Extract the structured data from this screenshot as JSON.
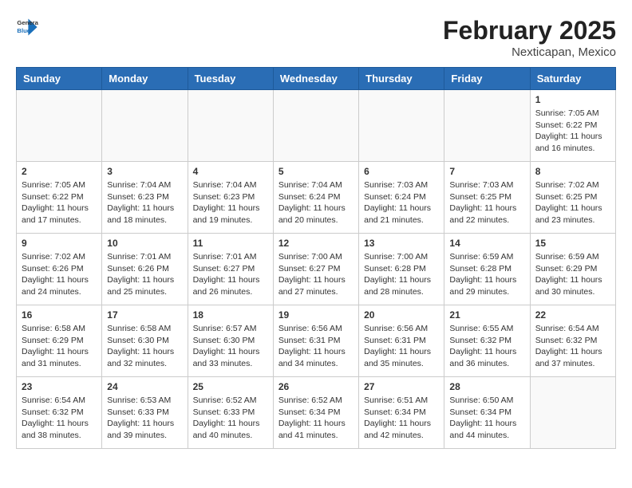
{
  "header": {
    "logo_text_general": "General",
    "logo_text_blue": "Blue",
    "month_year": "February 2025",
    "location": "Nexticapan, Mexico"
  },
  "weekdays": [
    "Sunday",
    "Monday",
    "Tuesday",
    "Wednesday",
    "Thursday",
    "Friday",
    "Saturday"
  ],
  "weeks": [
    [
      {
        "day": "",
        "info": ""
      },
      {
        "day": "",
        "info": ""
      },
      {
        "day": "",
        "info": ""
      },
      {
        "day": "",
        "info": ""
      },
      {
        "day": "",
        "info": ""
      },
      {
        "day": "",
        "info": ""
      },
      {
        "day": "1",
        "info": "Sunrise: 7:05 AM\nSunset: 6:22 PM\nDaylight: 11 hours\nand 16 minutes."
      }
    ],
    [
      {
        "day": "2",
        "info": "Sunrise: 7:05 AM\nSunset: 6:22 PM\nDaylight: 11 hours\nand 17 minutes."
      },
      {
        "day": "3",
        "info": "Sunrise: 7:04 AM\nSunset: 6:23 PM\nDaylight: 11 hours\nand 18 minutes."
      },
      {
        "day": "4",
        "info": "Sunrise: 7:04 AM\nSunset: 6:23 PM\nDaylight: 11 hours\nand 19 minutes."
      },
      {
        "day": "5",
        "info": "Sunrise: 7:04 AM\nSunset: 6:24 PM\nDaylight: 11 hours\nand 20 minutes."
      },
      {
        "day": "6",
        "info": "Sunrise: 7:03 AM\nSunset: 6:24 PM\nDaylight: 11 hours\nand 21 minutes."
      },
      {
        "day": "7",
        "info": "Sunrise: 7:03 AM\nSunset: 6:25 PM\nDaylight: 11 hours\nand 22 minutes."
      },
      {
        "day": "8",
        "info": "Sunrise: 7:02 AM\nSunset: 6:25 PM\nDaylight: 11 hours\nand 23 minutes."
      }
    ],
    [
      {
        "day": "9",
        "info": "Sunrise: 7:02 AM\nSunset: 6:26 PM\nDaylight: 11 hours\nand 24 minutes."
      },
      {
        "day": "10",
        "info": "Sunrise: 7:01 AM\nSunset: 6:26 PM\nDaylight: 11 hours\nand 25 minutes."
      },
      {
        "day": "11",
        "info": "Sunrise: 7:01 AM\nSunset: 6:27 PM\nDaylight: 11 hours\nand 26 minutes."
      },
      {
        "day": "12",
        "info": "Sunrise: 7:00 AM\nSunset: 6:27 PM\nDaylight: 11 hours\nand 27 minutes."
      },
      {
        "day": "13",
        "info": "Sunrise: 7:00 AM\nSunset: 6:28 PM\nDaylight: 11 hours\nand 28 minutes."
      },
      {
        "day": "14",
        "info": "Sunrise: 6:59 AM\nSunset: 6:28 PM\nDaylight: 11 hours\nand 29 minutes."
      },
      {
        "day": "15",
        "info": "Sunrise: 6:59 AM\nSunset: 6:29 PM\nDaylight: 11 hours\nand 30 minutes."
      }
    ],
    [
      {
        "day": "16",
        "info": "Sunrise: 6:58 AM\nSunset: 6:29 PM\nDaylight: 11 hours\nand 31 minutes."
      },
      {
        "day": "17",
        "info": "Sunrise: 6:58 AM\nSunset: 6:30 PM\nDaylight: 11 hours\nand 32 minutes."
      },
      {
        "day": "18",
        "info": "Sunrise: 6:57 AM\nSunset: 6:30 PM\nDaylight: 11 hours\nand 33 minutes."
      },
      {
        "day": "19",
        "info": "Sunrise: 6:56 AM\nSunset: 6:31 PM\nDaylight: 11 hours\nand 34 minutes."
      },
      {
        "day": "20",
        "info": "Sunrise: 6:56 AM\nSunset: 6:31 PM\nDaylight: 11 hours\nand 35 minutes."
      },
      {
        "day": "21",
        "info": "Sunrise: 6:55 AM\nSunset: 6:32 PM\nDaylight: 11 hours\nand 36 minutes."
      },
      {
        "day": "22",
        "info": "Sunrise: 6:54 AM\nSunset: 6:32 PM\nDaylight: 11 hours\nand 37 minutes."
      }
    ],
    [
      {
        "day": "23",
        "info": "Sunrise: 6:54 AM\nSunset: 6:32 PM\nDaylight: 11 hours\nand 38 minutes."
      },
      {
        "day": "24",
        "info": "Sunrise: 6:53 AM\nSunset: 6:33 PM\nDaylight: 11 hours\nand 39 minutes."
      },
      {
        "day": "25",
        "info": "Sunrise: 6:52 AM\nSunset: 6:33 PM\nDaylight: 11 hours\nand 40 minutes."
      },
      {
        "day": "26",
        "info": "Sunrise: 6:52 AM\nSunset: 6:34 PM\nDaylight: 11 hours\nand 41 minutes."
      },
      {
        "day": "27",
        "info": "Sunrise: 6:51 AM\nSunset: 6:34 PM\nDaylight: 11 hours\nand 42 minutes."
      },
      {
        "day": "28",
        "info": "Sunrise: 6:50 AM\nSunset: 6:34 PM\nDaylight: 11 hours\nand 44 minutes."
      },
      {
        "day": "",
        "info": ""
      }
    ]
  ]
}
